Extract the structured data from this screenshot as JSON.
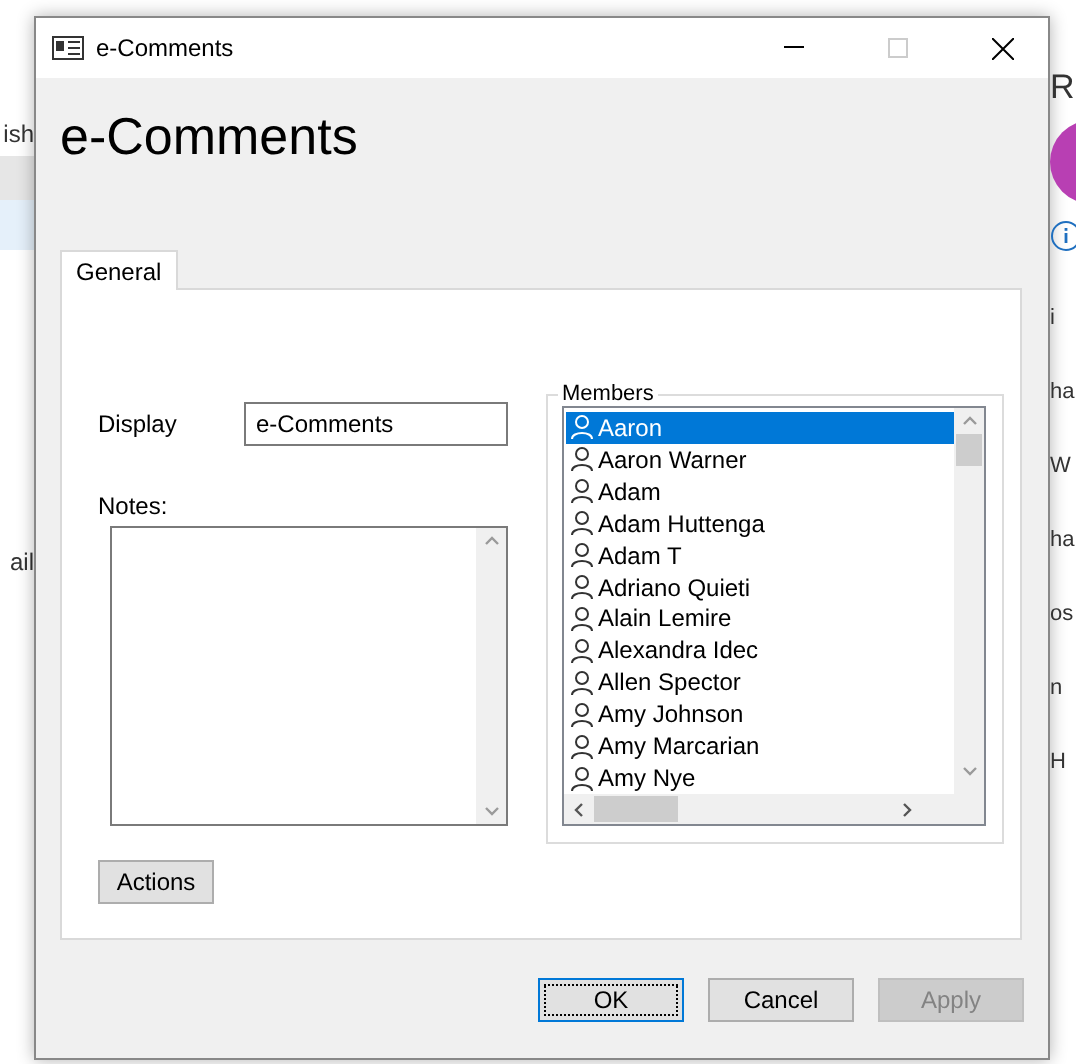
{
  "background": {
    "left_fragments": [
      "ish",
      "ail"
    ],
    "right_title": "R",
    "right_fragments": [
      "i",
      "ha",
      "W",
      "ha",
      "os",
      "n",
      "H"
    ]
  },
  "window": {
    "title": "e-Comments"
  },
  "heading": "e-Comments",
  "tabs": [
    {
      "label": "General",
      "selected": true
    }
  ],
  "display": {
    "label": "Display",
    "value": "e-Comments"
  },
  "notes": {
    "label": "Notes:"
  },
  "actions_button": "Actions",
  "members": {
    "label": "Members",
    "items": [
      {
        "name": "Aaron",
        "selected": true
      },
      {
        "name": "Aaron Warner",
        "selected": false
      },
      {
        "name": "Adam",
        "selected": false
      },
      {
        "name": "Adam Huttenga",
        "selected": false
      },
      {
        "name": "Adam T",
        "selected": false
      },
      {
        "name": "Adriano Quieti",
        "selected": false
      },
      {
        "name": "Alain Lemire",
        "selected": false
      },
      {
        "name": "Alexandra Idec",
        "selected": false
      },
      {
        "name": "Allen Spector",
        "selected": false
      },
      {
        "name": "Amy Johnson",
        "selected": false
      },
      {
        "name": "Amy Marcarian",
        "selected": false
      },
      {
        "name": "Amy Nye",
        "selected": false
      }
    ]
  },
  "buttons": [
    {
      "label": "OK",
      "kind": "default",
      "disabled": false
    },
    {
      "label": "Cancel",
      "kind": "normal",
      "disabled": false
    },
    {
      "label": "Apply",
      "kind": "normal",
      "disabled": true
    }
  ]
}
